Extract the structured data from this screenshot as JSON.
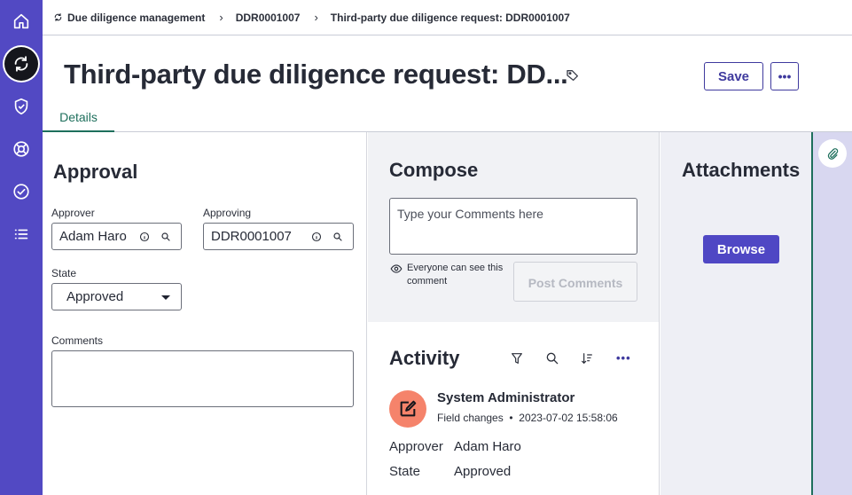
{
  "rail": {
    "items": [
      {
        "icon": "home-icon"
      },
      {
        "icon": "sync-icon",
        "active": true
      },
      {
        "icon": "shield-check-icon"
      },
      {
        "icon": "support-icon"
      },
      {
        "icon": "check-circle-icon"
      },
      {
        "icon": "list-icon"
      }
    ]
  },
  "breadcrumb": {
    "items": [
      "Due diligence management",
      "DDR0001007",
      "Third-party due diligence request: DDR0001007"
    ]
  },
  "header": {
    "title": "Third-party due diligence request: DD...",
    "save_label": "Save",
    "more_label": "•••"
  },
  "tabs": [
    {
      "label": "Details",
      "active": true
    }
  ],
  "approval": {
    "heading": "Approval",
    "approver_label": "Approver",
    "approver_value": "Adam Haro",
    "approving_label": "Approving",
    "approving_value": "DDR0001007",
    "state_label": "State",
    "state_value": "Approved",
    "comments_label": "Comments"
  },
  "compose": {
    "heading": "Compose",
    "placeholder": "Type your Comments here",
    "visibility_text": "Everyone can see this comment",
    "post_label": "Post Comments"
  },
  "activity": {
    "heading": "Activity",
    "user": "System Administrator",
    "change_type": "Field changes",
    "timestamp": "2023-07-02 15:58:06",
    "fields": [
      {
        "key": "Approver",
        "value": "Adam Haro"
      },
      {
        "key": "State",
        "value": "Approved"
      }
    ]
  },
  "attachments": {
    "heading": "Attachments",
    "browse_label": "Browse"
  },
  "colors": {
    "rail": "#5249c3",
    "accent": "#3f3a9e",
    "tab_active": "#1e6f5c",
    "avatar": "#f5836b"
  }
}
